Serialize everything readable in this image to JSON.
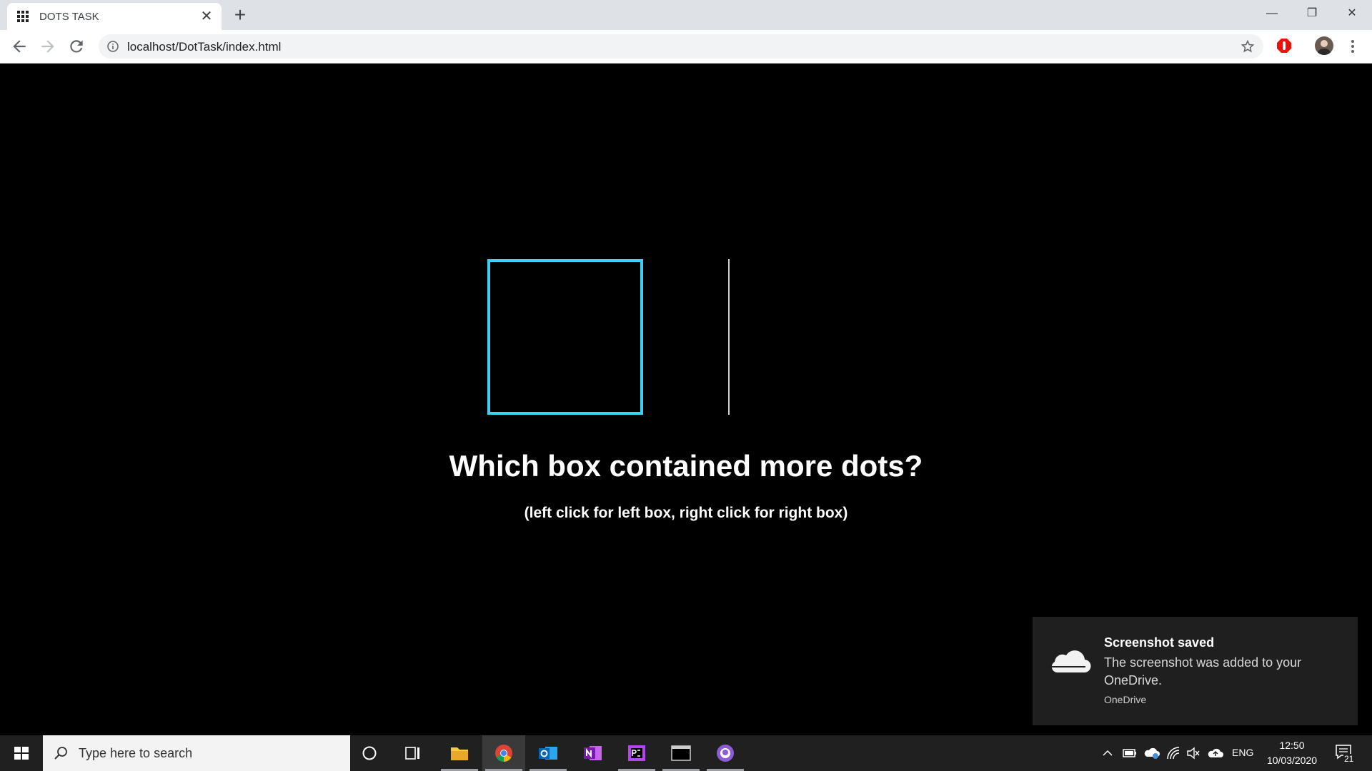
{
  "browser": {
    "tab_title": "DOTS TASK",
    "tab_close": "✕",
    "new_tab": "+",
    "url": "localhost/DotTask/index.html",
    "window_controls": {
      "minimize": "—",
      "restore": "❐",
      "close": "✕"
    }
  },
  "page": {
    "question": "Which box contained more dots?",
    "instruction": "(left click for left box, right click for right box)",
    "box_border_color": "#3cd0f5"
  },
  "toast": {
    "title": "Screenshot saved",
    "body": "The screenshot was added to your OneDrive.",
    "source": "OneDrive"
  },
  "taskbar": {
    "search_placeholder": "Type here to search",
    "language": "ENG",
    "time": "12:50",
    "date": "10/03/2020",
    "notification_count": "21",
    "apps": [
      "file-explorer",
      "chrome",
      "outlook",
      "onenote",
      "phpstorm",
      "terminal",
      "github-desktop"
    ]
  }
}
